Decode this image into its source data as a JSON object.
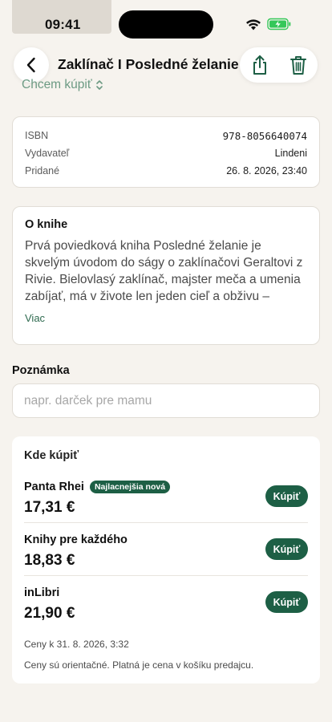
{
  "status_bar": {
    "time": "09:41"
  },
  "header": {
    "title": "Zaklínač I Posledné želanie"
  },
  "status_select": {
    "value": "Chcem kúpiť"
  },
  "metadata": [
    {
      "label": "ISBN",
      "value": "978-8056640074"
    },
    {
      "label": "Vydavateľ",
      "value": "Lindeni"
    },
    {
      "label": "Pridané",
      "value": "26. 8. 2026, 23:40"
    }
  ],
  "about": {
    "title": "O knihe",
    "text": "Prvá poviedková kniha Posledné želanie je skvelým úvodom do ságy o zaklínačovi Geraltovi z Rivie. Bielovlasý zaklínač, majster meča a umenia zabíjať, má v živote len jeden cieľ a obživu – zbavovať svet príšer. Odveké zaklínačské umenie chráni ľudstvo…",
    "more": "Viac"
  },
  "note": {
    "label": "Poznámka",
    "placeholder": "napr. darček pre mamu",
    "value": ""
  },
  "shops": {
    "title": "Kde kúpiť",
    "items": [
      {
        "name": "Panta Rhei",
        "badge": "Najlacnejšia nová",
        "price": "17,31 €",
        "buy": "Kúpiť"
      },
      {
        "name": "Knihy pre každého",
        "badge": "",
        "price": "18,83 €",
        "buy": "Kúpiť"
      },
      {
        "name": "inLibri",
        "badge": "",
        "price": "21,90 €",
        "buy": "Kúpiť"
      }
    ],
    "prices_date": "Ceny k 31. 8. 2026, 3:32",
    "disclaimer": "Ceny sú orientačné. Platná je cena v košíku predajcu."
  },
  "colors": {
    "accent": "#1d5f45",
    "accent_light": "#6c9a83",
    "background": "#f6f3ee",
    "battery": "#34c759"
  },
  "icons": [
    "wifi-icon",
    "battery-icon",
    "chevron-left-icon",
    "share-icon",
    "trash-icon",
    "chevron-updown-icon"
  ]
}
